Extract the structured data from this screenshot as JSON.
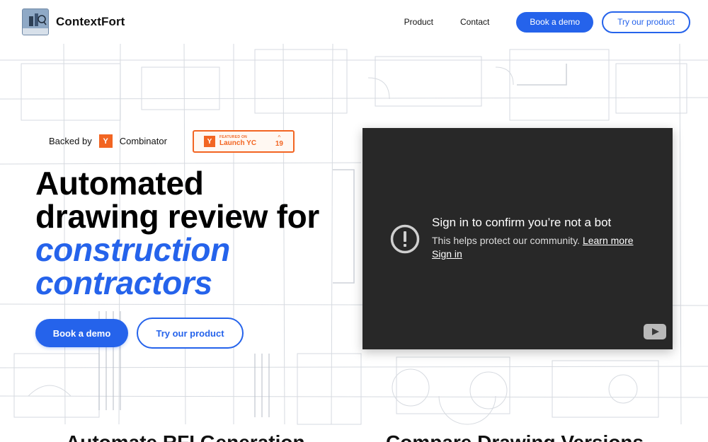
{
  "header": {
    "brand": "ContextFort",
    "nav": [
      "Product",
      "Contact"
    ],
    "book_demo": "Book a demo",
    "try_product": "Try our product"
  },
  "hero": {
    "backed_by_prefix": "Backed by",
    "yc_letter": "Y",
    "yc_name": "Combinator",
    "launch_badge": {
      "featured": "FEATURED ON",
      "name": "Launch YC",
      "count": "19"
    },
    "headline": {
      "line1": "Automated",
      "line2": "drawing review for",
      "accent1": "construction",
      "accent2": "contractors"
    },
    "cta_primary": "Book a demo",
    "cta_secondary": "Try our product"
  },
  "video": {
    "title": "Sign in to confirm you’re not a bot",
    "subtitle": "This helps protect our community.",
    "learn_more": "Learn more",
    "sign_in": "Sign in"
  },
  "features": {
    "left_heading": "Automate RFI Generation",
    "right_heading": "Compare Drawing Versions"
  },
  "colors": {
    "accent": "#2563eb",
    "yc_orange": "#f26522",
    "video_bg": "#282828"
  },
  "icons": [
    "logo-icon",
    "yc-logo-icon",
    "upvote-caret-icon",
    "alert-icon",
    "youtube-icon"
  ]
}
